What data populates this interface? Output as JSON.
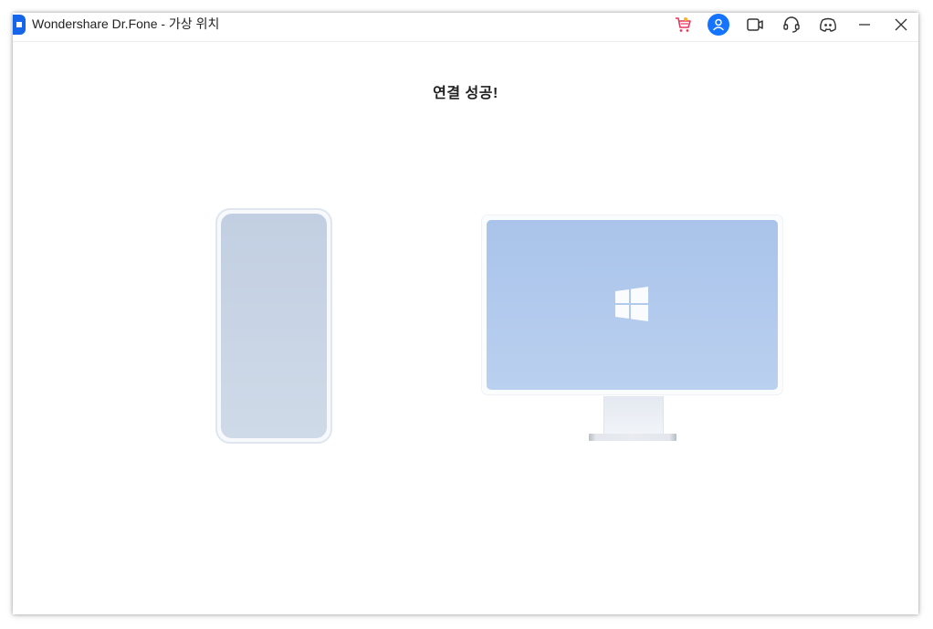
{
  "window": {
    "title": "Wondershare Dr.Fone - 가상 위치"
  },
  "titlebar": {
    "icons": [
      "cart-icon",
      "account-icon",
      "video-icon",
      "headset-icon",
      "discord-icon",
      "minimize-icon",
      "close-icon"
    ]
  },
  "main": {
    "heading": "연결 성공!"
  },
  "colors": {
    "brand": "#1565e8",
    "cart": "#e8365d",
    "account": "#1473ff",
    "phone_screen": "#c9d5e6",
    "monitor_screen": "#b1c9ec"
  }
}
